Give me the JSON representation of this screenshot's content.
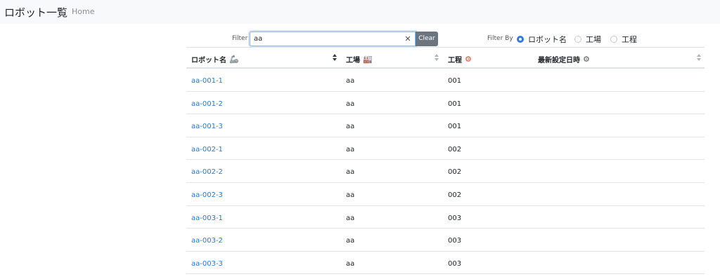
{
  "navbar": {
    "brand": "ロボット一覧",
    "home": "Home"
  },
  "filter": {
    "label": "Filter",
    "value": "aa",
    "clear_label": "Clear",
    "clear_icon": "x-icon",
    "by_label": "Filter By",
    "options": [
      {
        "label": "ロボット名",
        "checked": true
      },
      {
        "label": "工場",
        "checked": false
      },
      {
        "label": "工程",
        "checked": false
      }
    ]
  },
  "table": {
    "columns": [
      {
        "label": "ロボット名",
        "icon": "🦾",
        "icon_name": "robot-arm-icon",
        "sort": "asc"
      },
      {
        "label": "工場",
        "icon": "🏭",
        "icon_name": "factory-icon",
        "sort": "none"
      },
      {
        "label": "工程",
        "icon": "⚙",
        "icon_name": "process-icon",
        "sort": "none"
      },
      {
        "label": "最新設定日時",
        "icon": "⚙",
        "icon_name": "settings-gear-icon",
        "sort": "none"
      }
    ],
    "rows": [
      {
        "robot": "aa-001-1",
        "factory": "aa",
        "process": "001",
        "updated": ""
      },
      {
        "robot": "aa-001-2",
        "factory": "aa",
        "process": "001",
        "updated": ""
      },
      {
        "robot": "aa-001-3",
        "factory": "aa",
        "process": "001",
        "updated": ""
      },
      {
        "robot": "aa-002-1",
        "factory": "aa",
        "process": "002",
        "updated": ""
      },
      {
        "robot": "aa-002-2",
        "factory": "aa",
        "process": "002",
        "updated": ""
      },
      {
        "robot": "aa-002-3",
        "factory": "aa",
        "process": "002",
        "updated": ""
      },
      {
        "robot": "aa-003-1",
        "factory": "aa",
        "process": "003",
        "updated": ""
      },
      {
        "robot": "aa-003-2",
        "factory": "aa",
        "process": "003",
        "updated": ""
      },
      {
        "robot": "aa-003-3",
        "factory": "aa",
        "process": "003",
        "updated": ""
      }
    ]
  },
  "colors": {
    "link": "#1f7ae0",
    "accent": "#2f7ae5",
    "clear_button": "#6c757d"
  }
}
